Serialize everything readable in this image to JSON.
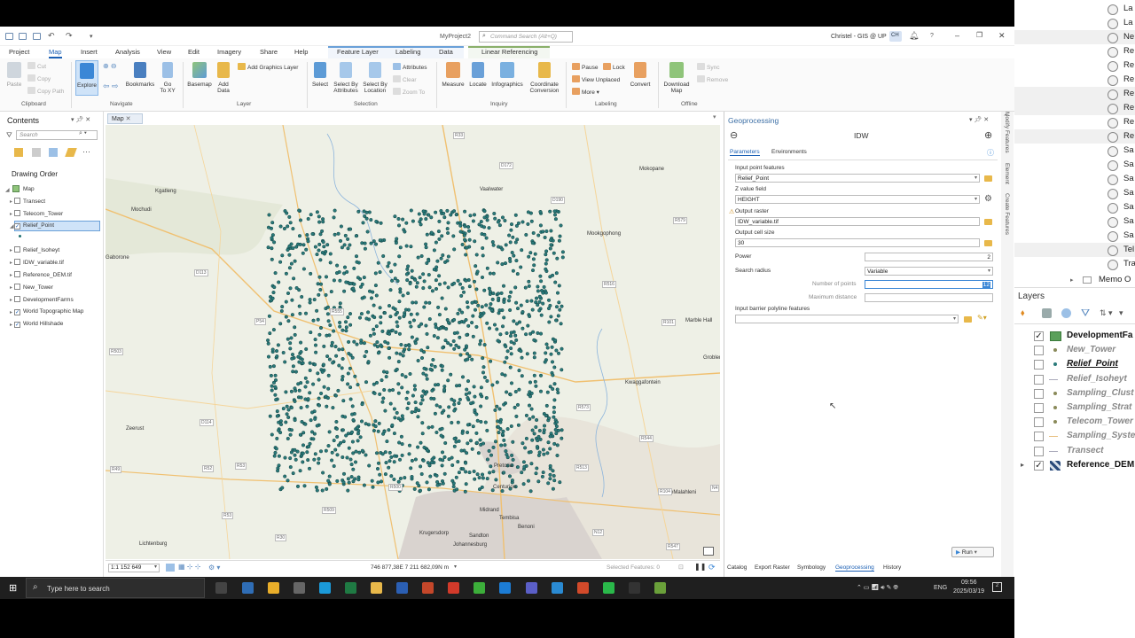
{
  "window": {
    "project": "MyProject2",
    "search_placeholder": "Command Search (Alt+Q)",
    "user": "Christel - GIS @ UP",
    "user_initials": "CH"
  },
  "tabs": {
    "project": "Project",
    "map": "Map",
    "insert": "Insert",
    "analysis": "Analysis",
    "view": "View",
    "edit": "Edit",
    "imagery": "Imagery",
    "share": "Share",
    "help": "Help",
    "feature_layer": "Feature Layer",
    "labeling": "Labeling",
    "data": "Data",
    "linear_referencing": "Linear Referencing"
  },
  "ribbon": {
    "paste": "Paste",
    "cut": "Cut",
    "copy": "Copy",
    "copy_path": "Copy Path",
    "clipboard": "Clipboard",
    "explore": "Explore",
    "bookmarks": "Bookmarks",
    "go_to_xy_1": "Go",
    "go_to_xy_2": "To XY",
    "navigate": "Navigate",
    "basemap": "Basemap",
    "add_data_1": "Add",
    "add_data_2": "Data",
    "add_graphics_layer": "Add Graphics Layer",
    "layer": "Layer",
    "select": "Select",
    "select_by_attr_1": "Select By",
    "select_by_attr_2": "Attributes",
    "select_by_loc_1": "Select By",
    "select_by_loc_2": "Location",
    "attributes": "Attributes",
    "clear": "Clear",
    "zoom_to": "Zoom To",
    "selection": "Selection",
    "measure": "Measure",
    "locate": "Locate",
    "infographics": "Infographics",
    "coord_conv_1": "Coordinate",
    "coord_conv_2": "Conversion",
    "inquiry": "Inquiry",
    "pause": "Pause",
    "lock": "Lock",
    "view_unplaced": "View Unplaced",
    "more": "More",
    "convert": "Convert",
    "labeling": "Labeling",
    "download_map_1": "Download",
    "download_map_2": "Map",
    "sync": "Sync",
    "remove": "Remove",
    "offline": "Offline"
  },
  "contents": {
    "title": "Contents",
    "search_placeholder": "Search",
    "drawing_order": "Drawing Order",
    "map": "Map",
    "layers": [
      {
        "name": "Transect",
        "checked": false
      },
      {
        "name": "Telecom_Tower",
        "checked": false
      },
      {
        "name": "Relief_Point",
        "checked": true
      },
      {
        "name": "Relief_Isoheyt",
        "checked": false
      },
      {
        "name": "IDW_variable.tif",
        "checked": false
      },
      {
        "name": "Reference_DEM.tif",
        "checked": false
      },
      {
        "name": "New_Tower",
        "checked": false
      },
      {
        "name": "DevelopmentFarms",
        "checked": false
      },
      {
        "name": "World Topographic Map",
        "checked": true
      },
      {
        "name": "World Hillshade",
        "checked": true
      }
    ]
  },
  "map": {
    "tab": "Map",
    "places": [
      "Kgatleng",
      "Mochudi",
      "Mokopane",
      "Vaalwater",
      "Mookgophong",
      "Marble Hall",
      "Groblersdal",
      "Kwaggafontein",
      "eMalahleni",
      "Zeerust",
      "Pretoria",
      "Centurion",
      "Midrand",
      "Tembisa",
      "Krugersdorp",
      "Sandton",
      "Benoni",
      "Johannesburg",
      "Lichtenburg",
      "Gaborone"
    ],
    "roads": [
      "R33",
      "D172",
      "D190",
      "R579",
      "R516",
      "R101",
      "R573",
      "R544",
      "R104",
      "R513",
      "R509",
      "R500",
      "R30",
      "R53",
      "R52",
      "R49",
      "R503",
      "D114",
      "D113",
      "P54",
      "R555",
      "N4",
      "R547",
      "N12",
      "R53"
    ],
    "scale": "1:1 152 649",
    "coordinates": "746 877,38E 7 211 682,09N m",
    "selected_features": "Selected Features: 0"
  },
  "geoprocessing": {
    "panel_title": "Geoprocessing",
    "tool": "IDW",
    "tab_parameters": "Parameters",
    "tab_environments": "Environments",
    "input_label": "Input point features",
    "input_value": "Relief_Point",
    "z_label": "Z value field",
    "z_value": "HEIGHT",
    "out_raster_label": "Output raster",
    "out_raster_value": "IDW_variable.tif",
    "cell_size_label": "Output cell size",
    "cell_size_value": "30",
    "power_label": "Power",
    "power_value": "2",
    "radius_label": "Search radius",
    "radius_value": "Variable",
    "num_points_label": "Number of points",
    "num_points_value": "12",
    "max_dist_label": "Maximum distance",
    "barrier_label": "Input barrier polyline features",
    "run": "Run"
  },
  "bottom_tabs": [
    "Catalog",
    "Export Raster",
    "Symbology",
    "Geoprocessing",
    "History"
  ],
  "side_tabs": [
    "Modify Features",
    "Element",
    "Create Features"
  ],
  "taskbar": {
    "search": "Type here to search",
    "time": "09:56",
    "date": "2025/03/19",
    "lang": "ENG"
  },
  "right_panel": {
    "list_items": [
      "La",
      "La",
      "Ne",
      "Re",
      "Re",
      "Re",
      "Re",
      "Re",
      "Re",
      "Re",
      "Sa",
      "Sa",
      "Sa",
      "Sa",
      "Sa",
      "Sa",
      "Sa",
      "Tel",
      "Tra"
    ],
    "memo": "Memo O",
    "layers_title": "Layers",
    "layers": [
      {
        "name": "DevelopmentFa",
        "checked": true,
        "active": true
      },
      {
        "name": "New_Tower",
        "checked": false,
        "active": false
      },
      {
        "name": "Relief_Point",
        "checked": false,
        "active": true,
        "underline": true
      },
      {
        "name": "Relief_Isoheyt",
        "checked": false,
        "active": false
      },
      {
        "name": "Sampling_Clust",
        "checked": false,
        "active": false
      },
      {
        "name": "Sampling_Strat",
        "checked": false,
        "active": false
      },
      {
        "name": "Telecom_Tower",
        "checked": false,
        "active": false
      },
      {
        "name": "Sampling_Syste",
        "checked": false,
        "active": false
      },
      {
        "name": "Transect",
        "checked": false,
        "active": false
      },
      {
        "name": "Reference_DEM",
        "checked": true,
        "active": true
      }
    ]
  }
}
